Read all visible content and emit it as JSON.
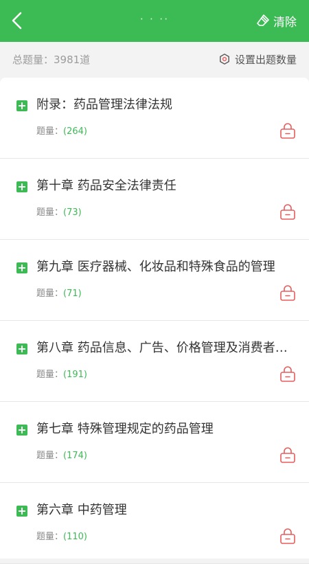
{
  "header": {
    "back_icon": "chevron-left-icon",
    "title": "· · ··",
    "clear_icon": "eraser-icon",
    "clear_label": "清除",
    "color": "#3cba54"
  },
  "summary": {
    "total_text": "总题量：3981道",
    "settings_icon": "gear-icon",
    "settings_label": "设置出题数量"
  },
  "count_label": "题量：",
  "chapters": [
    {
      "title": "附录：药品管理法律法规",
      "count": "(264)"
    },
    {
      "title": "第十章 药品安全法律责任",
      "count": "(73)"
    },
    {
      "title": "第九章 医疗器械、化妆品和特殊食品的管理",
      "count": "(71)"
    },
    {
      "title": "第八章 药品信息、广告、价格管理及消费者…",
      "count": "(191)"
    },
    {
      "title": "第七章 特殊管理规定的药品管理",
      "count": "(174)"
    },
    {
      "title": "第六章 中药管理",
      "count": "(110)"
    }
  ],
  "colors": {
    "accent": "#3cba54",
    "lock": "#e85b5b"
  }
}
